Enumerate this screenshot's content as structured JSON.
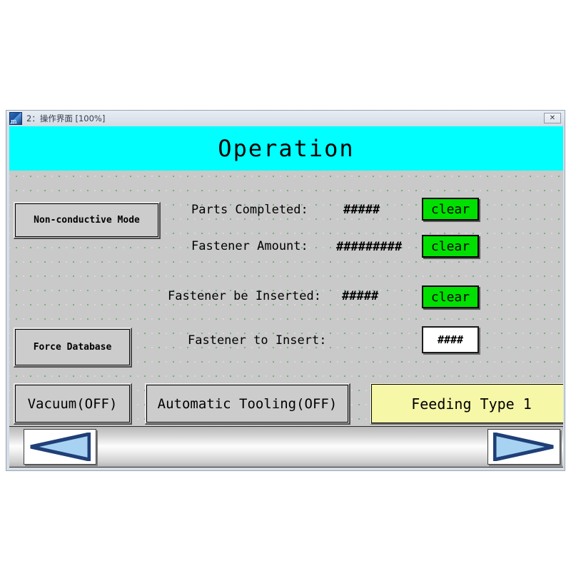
{
  "window": {
    "title": "2：操作界面 [100%]",
    "close_label": "✕",
    "app_icon": "app-window-icon"
  },
  "banner": {
    "title": "Operation",
    "background_color": "#00ffff"
  },
  "buttons": {
    "non_conductive_mode": "Non-conductive Mode",
    "force_database": "Force Database",
    "vacuum": "Vacuum(OFF)",
    "automatic_tooling": "Automatic Tooling(OFF)",
    "feeding_type": "Feeding Type 1"
  },
  "rows": [
    {
      "label": "Parts Completed:",
      "value": "#####",
      "action_label": "clear",
      "action_color": "#00e000"
    },
    {
      "label": "Fastener Amount:",
      "value": "#########",
      "action_label": "clear",
      "action_color": "#00e000"
    },
    {
      "label": "Fastener be Inserted:",
      "value": "#####",
      "action_label": "clear",
      "action_color": "#00e000"
    }
  ],
  "input_row": {
    "label": "Fastener to Insert:",
    "value": "####",
    "placeholder": "####"
  },
  "navbar": {
    "prev_icon": "left-triangle-icon",
    "next_icon": "right-triangle-icon"
  },
  "colors": {
    "canvas": "#c9c9c9",
    "grid_dot": "#3c9f4a",
    "banner": "#00ffff",
    "clear_green": "#00e000",
    "feeding_yellow": "#f7f7a8",
    "arrow_fill": "#a8d2f2",
    "arrow_border": "#1f3f77"
  }
}
